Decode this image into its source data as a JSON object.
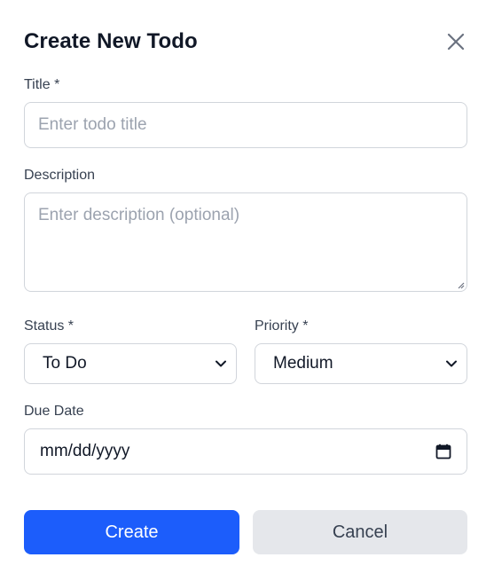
{
  "modal": {
    "title": "Create New Todo",
    "close_icon": "close-icon"
  },
  "form": {
    "title_label": "Title *",
    "title_placeholder": "Enter todo title",
    "title_value": "",
    "description_label": "Description",
    "description_placeholder": "Enter description (optional)",
    "description_value": "",
    "status_label": "Status *",
    "status_value": "To Do",
    "priority_label": "Priority *",
    "priority_value": "Medium",
    "due_date_label": "Due Date",
    "due_date_placeholder": "mm/dd/yyyy",
    "calendar_icon": "calendar-icon",
    "chevron_icon": "chevron-down-icon"
  },
  "actions": {
    "create_label": "Create",
    "cancel_label": "Cancel"
  },
  "colors": {
    "primary": "#1c5dfb",
    "secondary": "#e5e7eb",
    "border": "#d1d5db",
    "placeholder": "#9ca3af"
  }
}
